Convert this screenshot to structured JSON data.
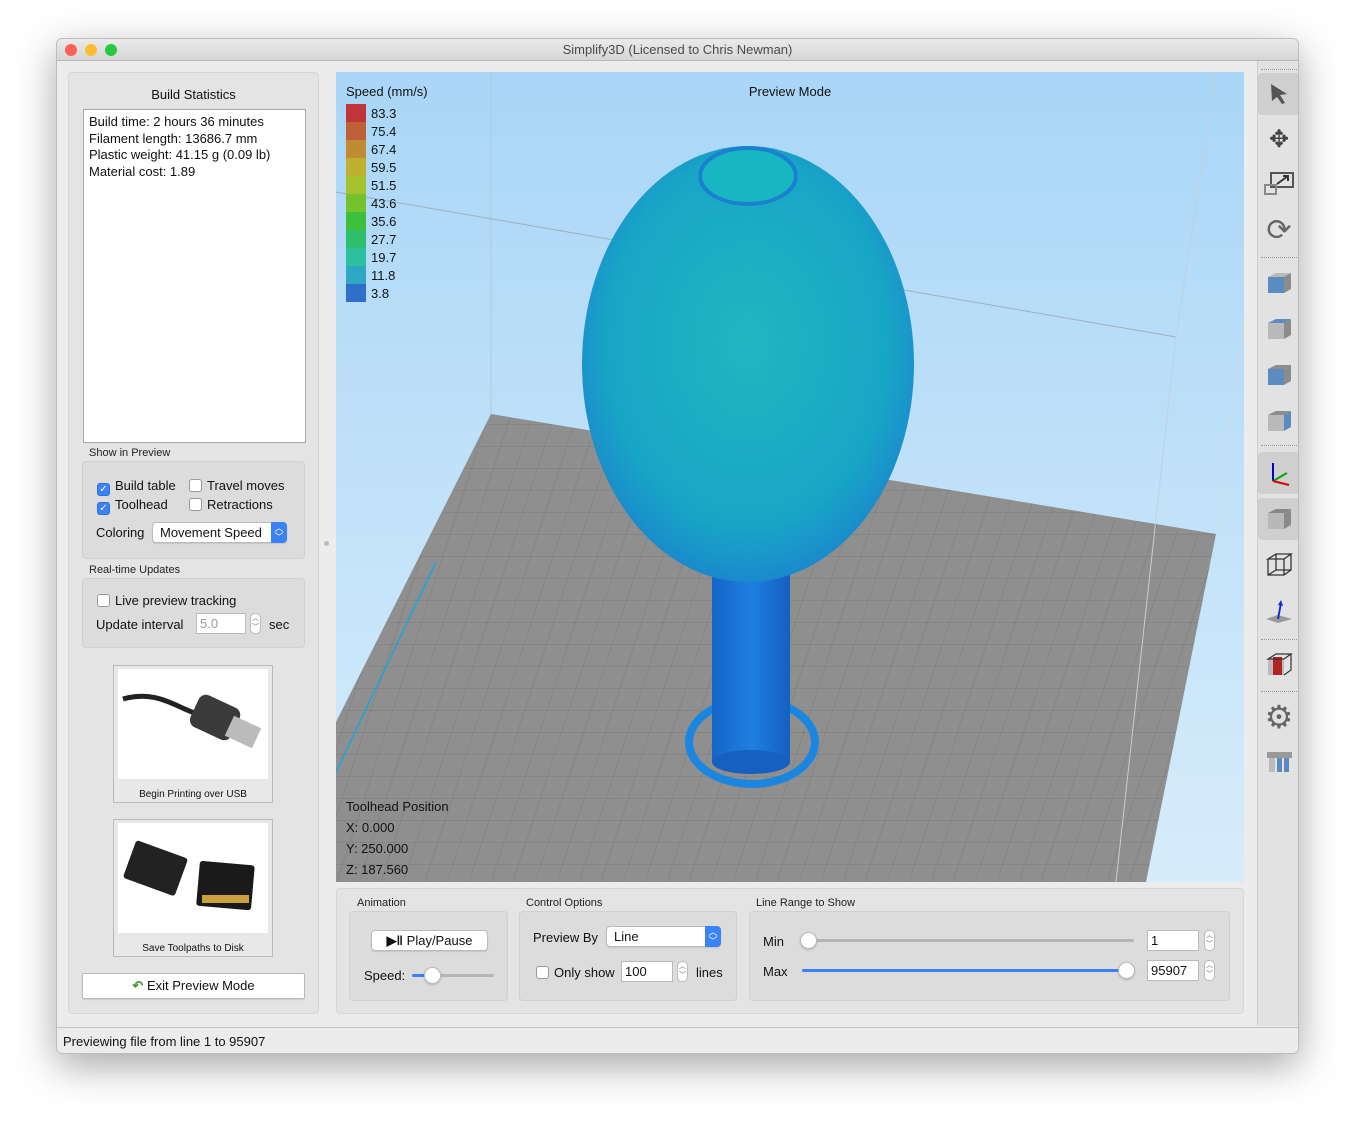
{
  "window": {
    "title": "Simplify3D (Licensed to Chris Newman)"
  },
  "build_statistics": {
    "title": "Build Statistics",
    "lines": [
      "Build time: 2 hours 36 minutes",
      "Filament length: 13686.7 mm",
      "Plastic weight: 41.15 g (0.09 lb)",
      "Material cost: 1.89"
    ]
  },
  "show_in_preview": {
    "title": "Show in Preview",
    "build_table": {
      "label": "Build table",
      "checked": true
    },
    "travel_moves": {
      "label": "Travel moves",
      "checked": false
    },
    "toolhead": {
      "label": "Toolhead",
      "checked": true
    },
    "retractions": {
      "label": "Retractions",
      "checked": false
    },
    "coloring_label": "Coloring",
    "coloring_value": "Movement Speed"
  },
  "realtime": {
    "title": "Real-time Updates",
    "live_tracking": {
      "label": "Live preview tracking",
      "checked": false
    },
    "interval_label": "Update interval",
    "interval_value": "5.0",
    "interval_unit": "sec"
  },
  "tiles": {
    "usb": "Begin Printing over USB",
    "disk": "Save Toolpaths to Disk"
  },
  "exit_button": "Exit Preview Mode",
  "viewport": {
    "mode_label": "Preview Mode",
    "legend_title": "Speed (mm/s)",
    "legend": [
      {
        "value": "83.3",
        "color": "#c0343a"
      },
      {
        "value": "75.4",
        "color": "#c06038"
      },
      {
        "value": "67.4",
        "color": "#bf8c34"
      },
      {
        "value": "59.5",
        "color": "#bfb02e"
      },
      {
        "value": "51.5",
        "color": "#a6c22e"
      },
      {
        "value": "43.6",
        "color": "#74c22e"
      },
      {
        "value": "35.6",
        "color": "#3cbf3a"
      },
      {
        "value": "27.7",
        "color": "#2fbf6a"
      },
      {
        "value": "19.7",
        "color": "#2ebf9e"
      },
      {
        "value": "11.8",
        "color": "#2ea8c2"
      },
      {
        "value": "3.8",
        "color": "#2f6fc7"
      }
    ],
    "toolhead_title": "Toolhead Position",
    "x": "X: 0.000",
    "y": "Y: 250.000",
    "z": "Z: 187.560"
  },
  "animation": {
    "title": "Animation",
    "play_pause": "Play/Pause",
    "speed_label": "Speed:",
    "speed": 0.15
  },
  "control_options": {
    "title": "Control Options",
    "preview_by_label": "Preview By",
    "preview_by_value": "Line",
    "only_show_label": "Only show",
    "only_show_checked": false,
    "only_show_value": "100",
    "lines_label": "lines"
  },
  "line_range": {
    "title": "Line Range to Show",
    "min_label": "Min",
    "min_value": "1",
    "max_label": "Max",
    "max_value": "95907"
  },
  "status_bar": "Previewing file from line 1 to 95907"
}
